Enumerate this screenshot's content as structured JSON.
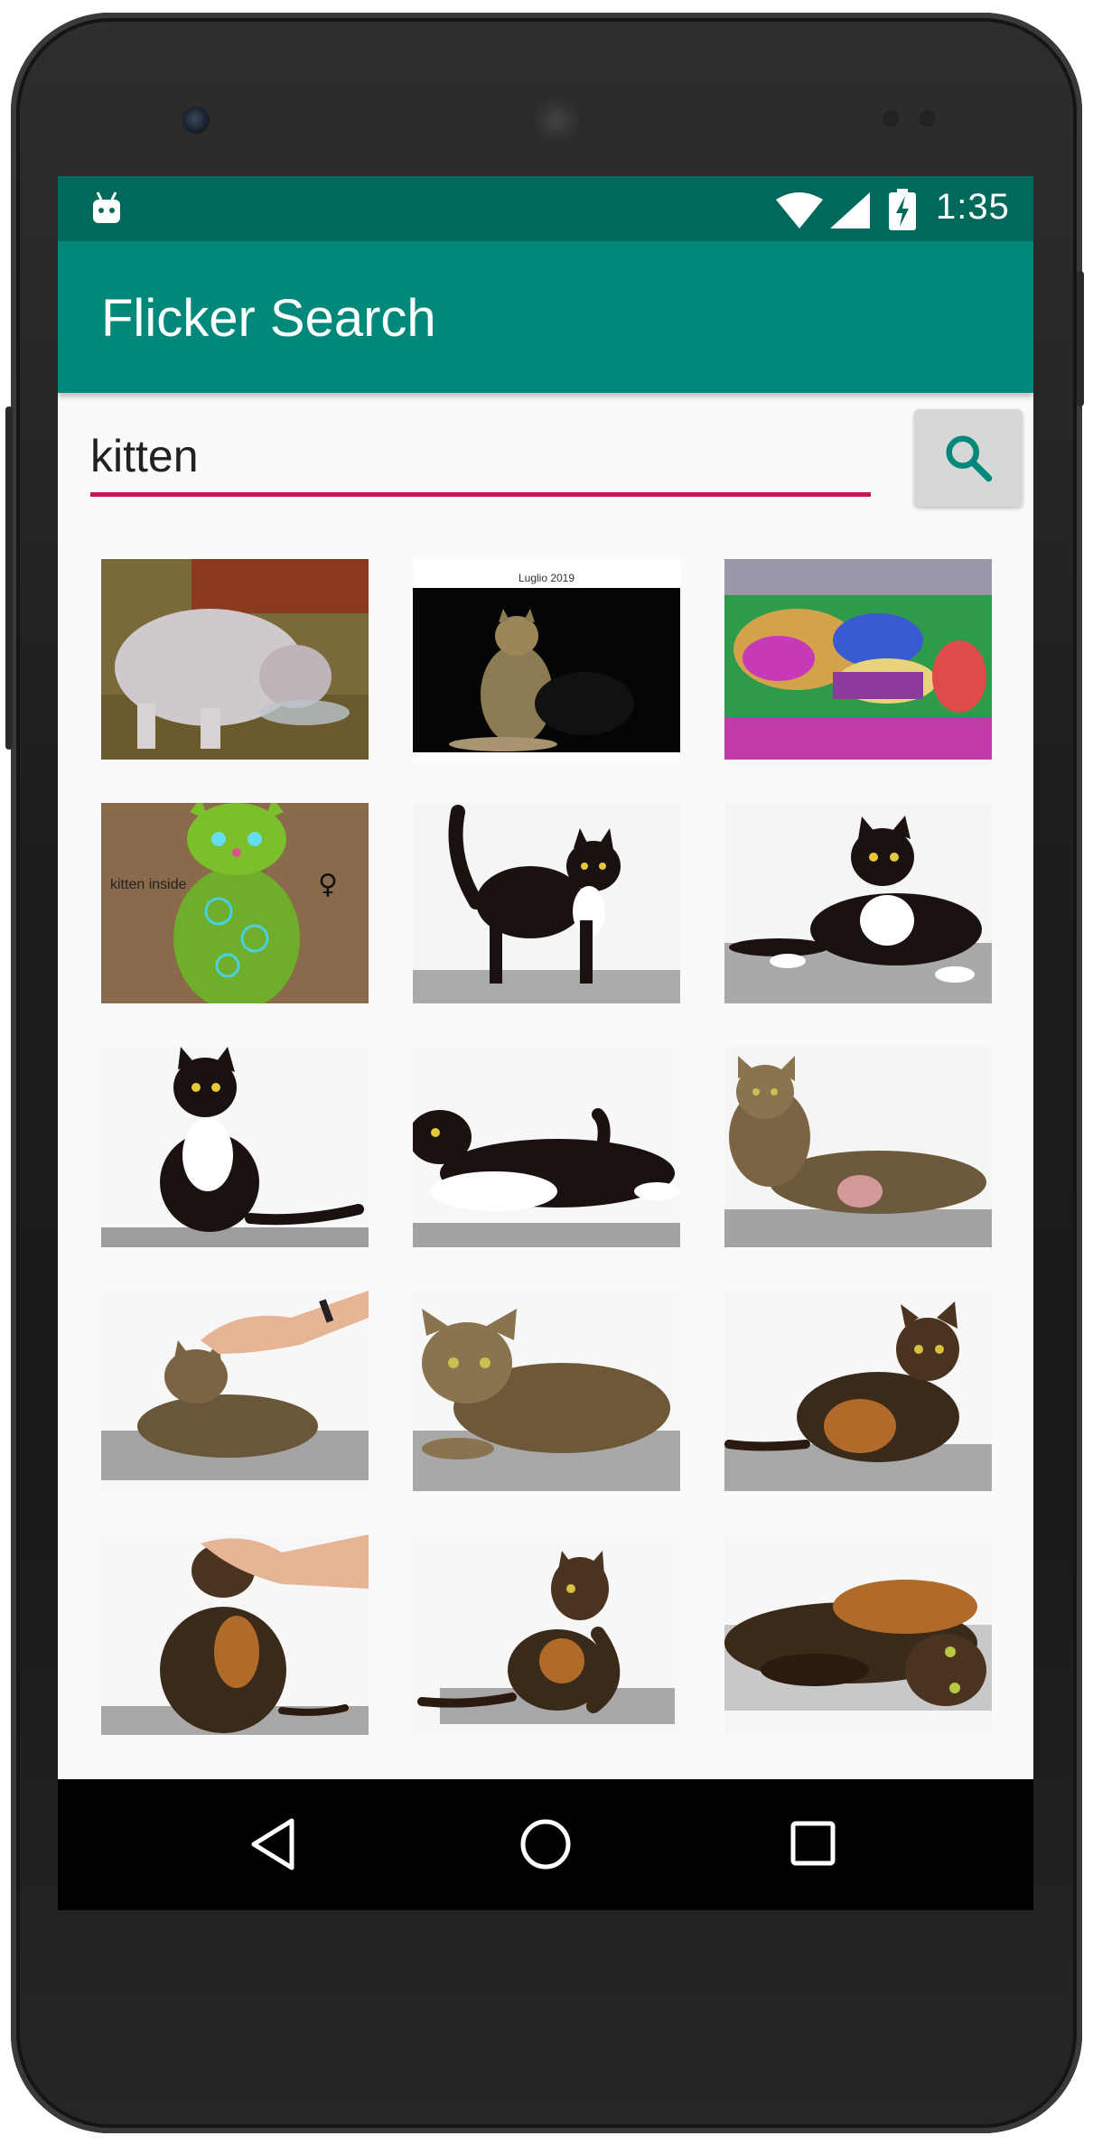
{
  "status_bar": {
    "time": "1:35",
    "icons": [
      "android-icon",
      "wifi-icon",
      "signal-icon",
      "battery-charging-icon"
    ]
  },
  "app_bar": {
    "title": "Flicker Search",
    "color": "#00897b",
    "status_color": "#00695c"
  },
  "search": {
    "value": "kitten",
    "underline_color": "#c2185b",
    "button_icon": "search-icon"
  },
  "results": [
    {
      "desc": "grey cat drinking from bowl"
    },
    {
      "desc": "tabby cat on black background",
      "caption": "Luglio 2019"
    },
    {
      "desc": "psychedelic colored cat photo"
    },
    {
      "desc": "green cat drawing",
      "caption": "kitten inside"
    },
    {
      "desc": "tuxedo cat standing"
    },
    {
      "desc": "tuxedo cat lying"
    },
    {
      "desc": "tuxedo cat sitting"
    },
    {
      "desc": "tuxedo cat lying on side"
    },
    {
      "desc": "tabby cat lying"
    },
    {
      "desc": "tabby cat being petted"
    },
    {
      "desc": "tabby cat lying down"
    },
    {
      "desc": "tortoiseshell cat crouching"
    },
    {
      "desc": "tortoiseshell cat being petted"
    },
    {
      "desc": "tortoiseshell cat stretching"
    },
    {
      "desc": "tortoiseshell cat lying on side"
    }
  ],
  "nav_bar": {
    "buttons": [
      "back-icon",
      "home-icon",
      "recents-icon"
    ]
  }
}
